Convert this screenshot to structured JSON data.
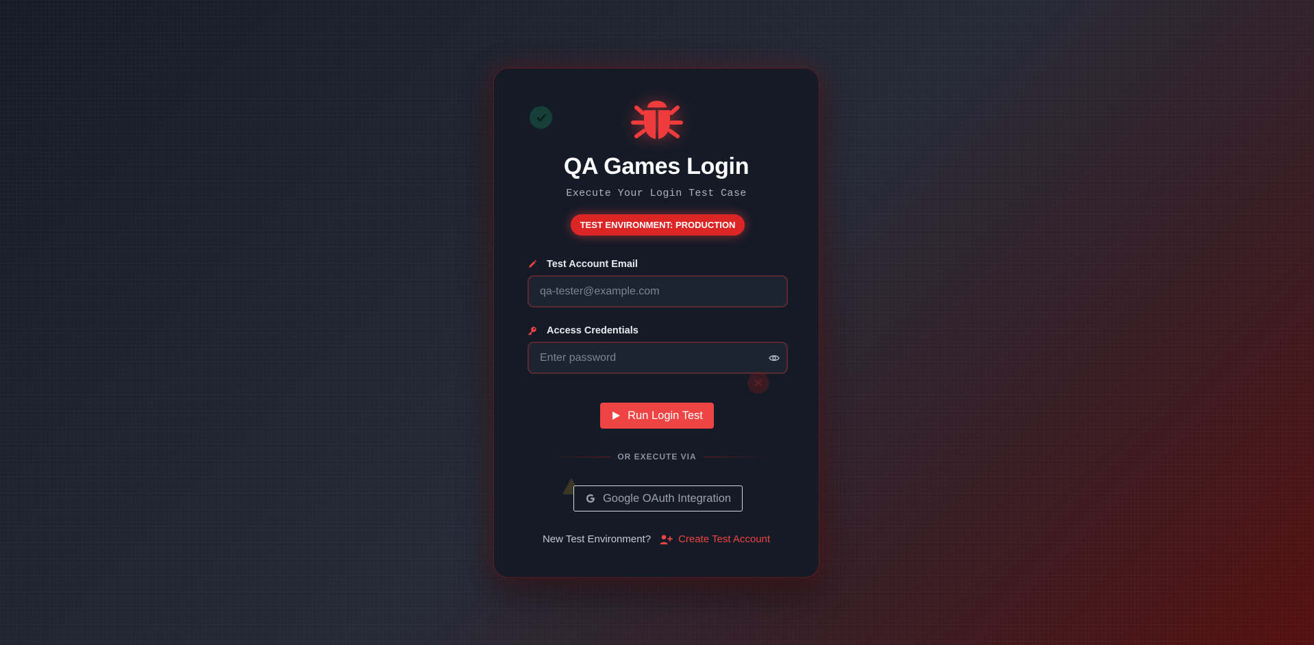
{
  "app": {
    "title": "QA Games Login",
    "subtitle": "Execute Your Login Test Case",
    "environment_badge": "TEST ENVIRONMENT: PRODUCTION"
  },
  "icons": {
    "logo": "bug-icon",
    "status": "check-circle-icon",
    "email_label": "pencil-icon",
    "password_label": "key-icon",
    "toggle_password": "eye-icon",
    "error_indicator": "close-icon",
    "run_button": "play-icon",
    "oauth": "google-g-icon",
    "warning": "warning-triangle-icon",
    "signup": "user-plus-icon"
  },
  "form": {
    "email": {
      "label": "Test Account Email",
      "placeholder": "qa-tester@example.com",
      "value": ""
    },
    "password": {
      "label": "Access Credentials",
      "placeholder": "Enter password",
      "value": ""
    },
    "submit_label": "Run Login Test"
  },
  "divider_text": "OR EXECUTE VIA",
  "oauth_label": "Google OAuth Integration",
  "signup": {
    "prompt": "New Test Environment?",
    "link_label": "Create Test Account"
  },
  "colors": {
    "accent": "#ef4444",
    "badge": "#dc2626",
    "card_background": "#141a26",
    "success": "#18443c"
  }
}
